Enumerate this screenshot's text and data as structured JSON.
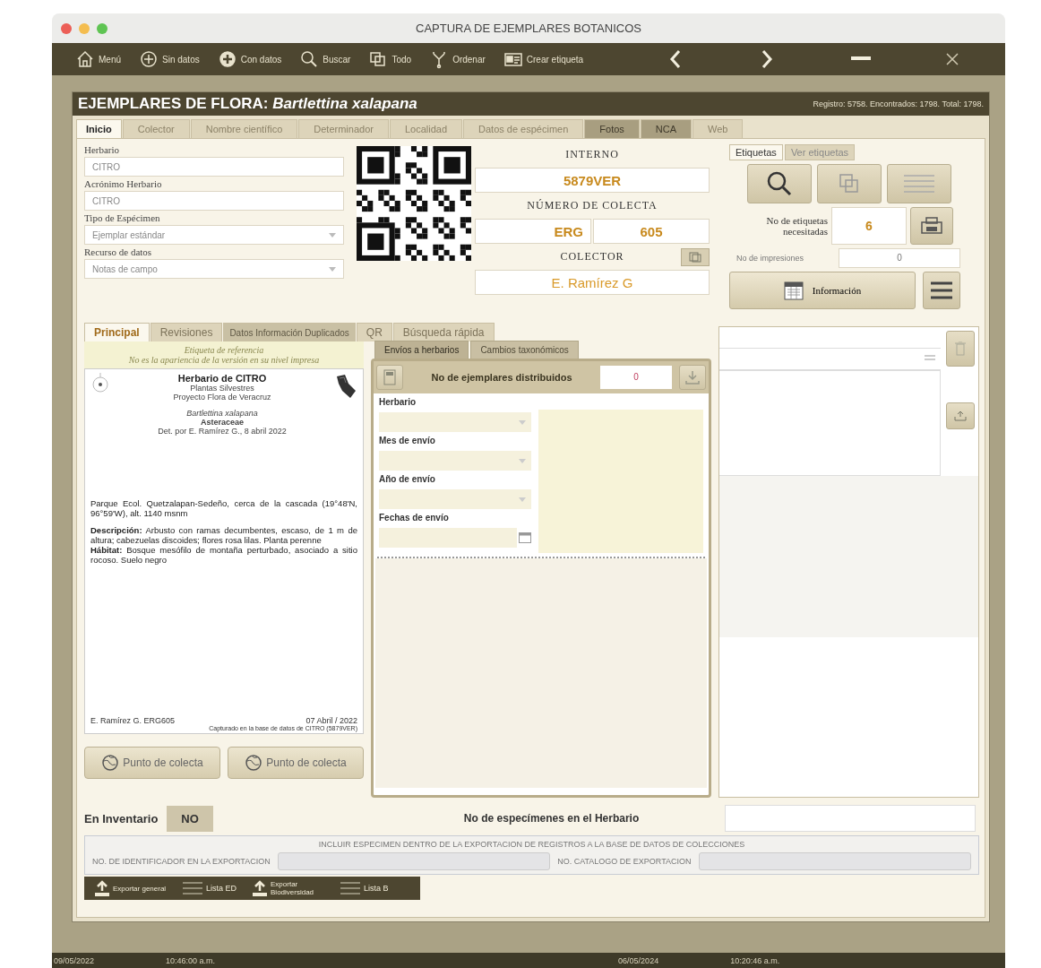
{
  "window": {
    "title": "CAPTURA DE EJEMPLARES BOTANICOS"
  },
  "toolbar": [
    {
      "label": "Menú"
    },
    {
      "label": "Sin datos"
    },
    {
      "label": "Con datos"
    },
    {
      "label": "Buscar"
    },
    {
      "label": "Todo"
    },
    {
      "label": "Ordenar"
    },
    {
      "label": "Crear etiqueta"
    }
  ],
  "header": {
    "title": "EJEMPLARES DE FLORA:",
    "species": "Bartlettina xalapana",
    "stats": "Registro: 5758. Encontrados: 1798. Total: 1798."
  },
  "tabs": [
    {
      "label": "Inicio",
      "selected": true,
      "disabled": false
    },
    {
      "label": "Colector",
      "selected": false,
      "disabled": false
    },
    {
      "label": "Nombre científico",
      "selected": false,
      "disabled": false
    },
    {
      "label": "Determinador",
      "selected": false,
      "disabled": false
    },
    {
      "label": "Localidad",
      "selected": false,
      "disabled": false
    },
    {
      "label": "Datos de espécimen",
      "selected": false,
      "disabled": false
    },
    {
      "label": "Fotos",
      "selected": false,
      "disabled": true
    },
    {
      "label": "NCA",
      "selected": false,
      "disabled": true
    },
    {
      "label": "Web",
      "selected": false,
      "disabled": false
    }
  ],
  "fields": [
    {
      "label": "Herbario",
      "value": "CITRO",
      "kind": "text"
    },
    {
      "label": "Acrónimo Herbario",
      "value": "CITRO",
      "kind": "text"
    },
    {
      "label": "Tipo de Espécimen",
      "value": "Ejemplar estándar",
      "kind": "select"
    },
    {
      "label": "Recurso de datos",
      "value": "Notas de campo",
      "kind": "select"
    }
  ],
  "ids": {
    "internal_label": "INTERNO",
    "internal": "5879VER",
    "number_label": "NÚMERO DE COLECTA",
    "prefix": "ERG",
    "number": "605",
    "collector_label": "COLECTOR",
    "collector": "E. Ramírez G"
  },
  "label_tabs": [
    {
      "label": "Etiquetas",
      "selected": true
    },
    {
      "label": "Ver etiquetas",
      "selected": false
    }
  ],
  "labels_needed": {
    "label": "No de etiquetas necesitadas",
    "value": "6"
  },
  "prints": {
    "label": "No de impresiones",
    "value": "0"
  },
  "info_button": "Información",
  "subtabs": [
    {
      "label": "Principal",
      "selected": true,
      "disabled": false
    },
    {
      "label": "Revisiones",
      "selected": false,
      "disabled": false
    },
    {
      "label": "Datos Información Duplicados",
      "selected": false,
      "disabled": true
    },
    {
      "label": "QR",
      "selected": false,
      "disabled": false
    },
    {
      "label": "Búsqueda rápida",
      "selected": false,
      "disabled": false
    }
  ],
  "preview": {
    "note": [
      "Etiqueta de referencia",
      "No es la apariencia de la versión en su nivel impresa"
    ],
    "lines": [
      {
        "text": "Herbario de CITRO",
        "kind": "title"
      },
      {
        "text": "Plantas Silvestres",
        "kind": "plain"
      },
      {
        "text": "Proyecto Flora de Veracruz",
        "kind": "plain"
      },
      {
        "text": "Bartlettina xalapana",
        "kind": "italic"
      },
      {
        "text": "Asteraceae",
        "kind": "bold"
      },
      {
        "text": "Det. por E. Ramírez G., 8 abril 2022",
        "kind": "plain"
      }
    ],
    "paragraphs": [
      "Parque Ecol. Quetzalapan-Sedeño, cerca de la cascada (19°48'N, 96°59'W), alt. 1140 msnm",
      "**Descripción:** Arbusto con ramas decumbentes, escaso, de 1 m de altura; cabezuelas discoides; flores rosa lilas. Planta perenne",
      "**Hábitat:** Bosque mesófilo de montaña perturbado, asociado a sitio rocoso. Suelo negro"
    ],
    "collector": "E. Ramírez G. ERG605",
    "date": "07 Abril / 2022",
    "footer": "Capturado en la base de datos de CITRO (5879VER)"
  },
  "point_buttons": [
    "Punto de colecta",
    "Punto de colecta"
  ],
  "shipments": {
    "tabs": [
      {
        "label": "Envíos a herbarios",
        "selected": true
      },
      {
        "label": "Cambios taxonómicos",
        "selected": false
      }
    ],
    "count_label": "No de ejemplares distribuidos",
    "count": "0",
    "fields": [
      {
        "label": "Herbario",
        "kind": "select"
      },
      {
        "label": "Mes de envío",
        "kind": "select"
      },
      {
        "label": "Año de envío",
        "kind": "select"
      },
      {
        "label": "Fechas de envío",
        "kind": "date"
      }
    ]
  },
  "inventory": {
    "label": "En Inventario",
    "value": "NO",
    "count_label": "No de especímenes en el Herbario"
  },
  "export_box": {
    "title": "INCLUIR ESPECIMEN DENTRO DE LA EXPORTACION DE REGISTROS A LA BASE DE DATOS DE COLECCIONES",
    "left_label": "NO. DE IDENTIFICADOR EN LA EXPORTACION",
    "right_label": "NO. CATALOGO DE EXPORTACION"
  },
  "bottom_toolbar": [
    {
      "label": "Exportar general",
      "kind": "export"
    },
    {
      "label": "Lista ED",
      "kind": "list"
    },
    {
      "label": "Exportar Biodiversidad",
      "kind": "export"
    },
    {
      "label": "Lista B",
      "kind": "list"
    }
  ],
  "status_bar": [
    "09/05/2022",
    "10:46:00 a.m.",
    "06/05/2024",
    "10:20:46 a.m."
  ]
}
